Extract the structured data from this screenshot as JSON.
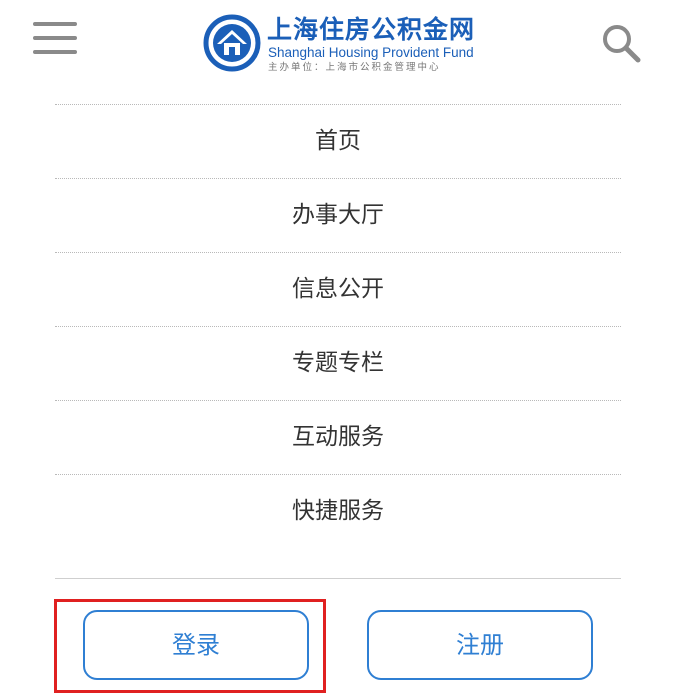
{
  "header": {
    "menu_icon": "hamburger-menu-icon",
    "search_icon": "search-icon",
    "logo": {
      "emblem_icon": "house-emblem-icon",
      "title_cn": "上海住房公积金网",
      "title_en": "Shanghai Housing Provident Fund",
      "sponsor": "主办单位：上海市公积金管理中心"
    }
  },
  "nav": {
    "items": [
      {
        "label": "首页"
      },
      {
        "label": "办事大厅"
      },
      {
        "label": "信息公开"
      },
      {
        "label": "专题专栏"
      },
      {
        "label": "互动服务"
      },
      {
        "label": "快捷服务"
      }
    ]
  },
  "actions": {
    "login_label": "登录",
    "register_label": "注册"
  },
  "colors": {
    "brand_blue": "#1b5fb8",
    "button_blue": "#2f7fd3",
    "highlight_red": "#e02020",
    "icon_gray": "#8a8a8a"
  }
}
